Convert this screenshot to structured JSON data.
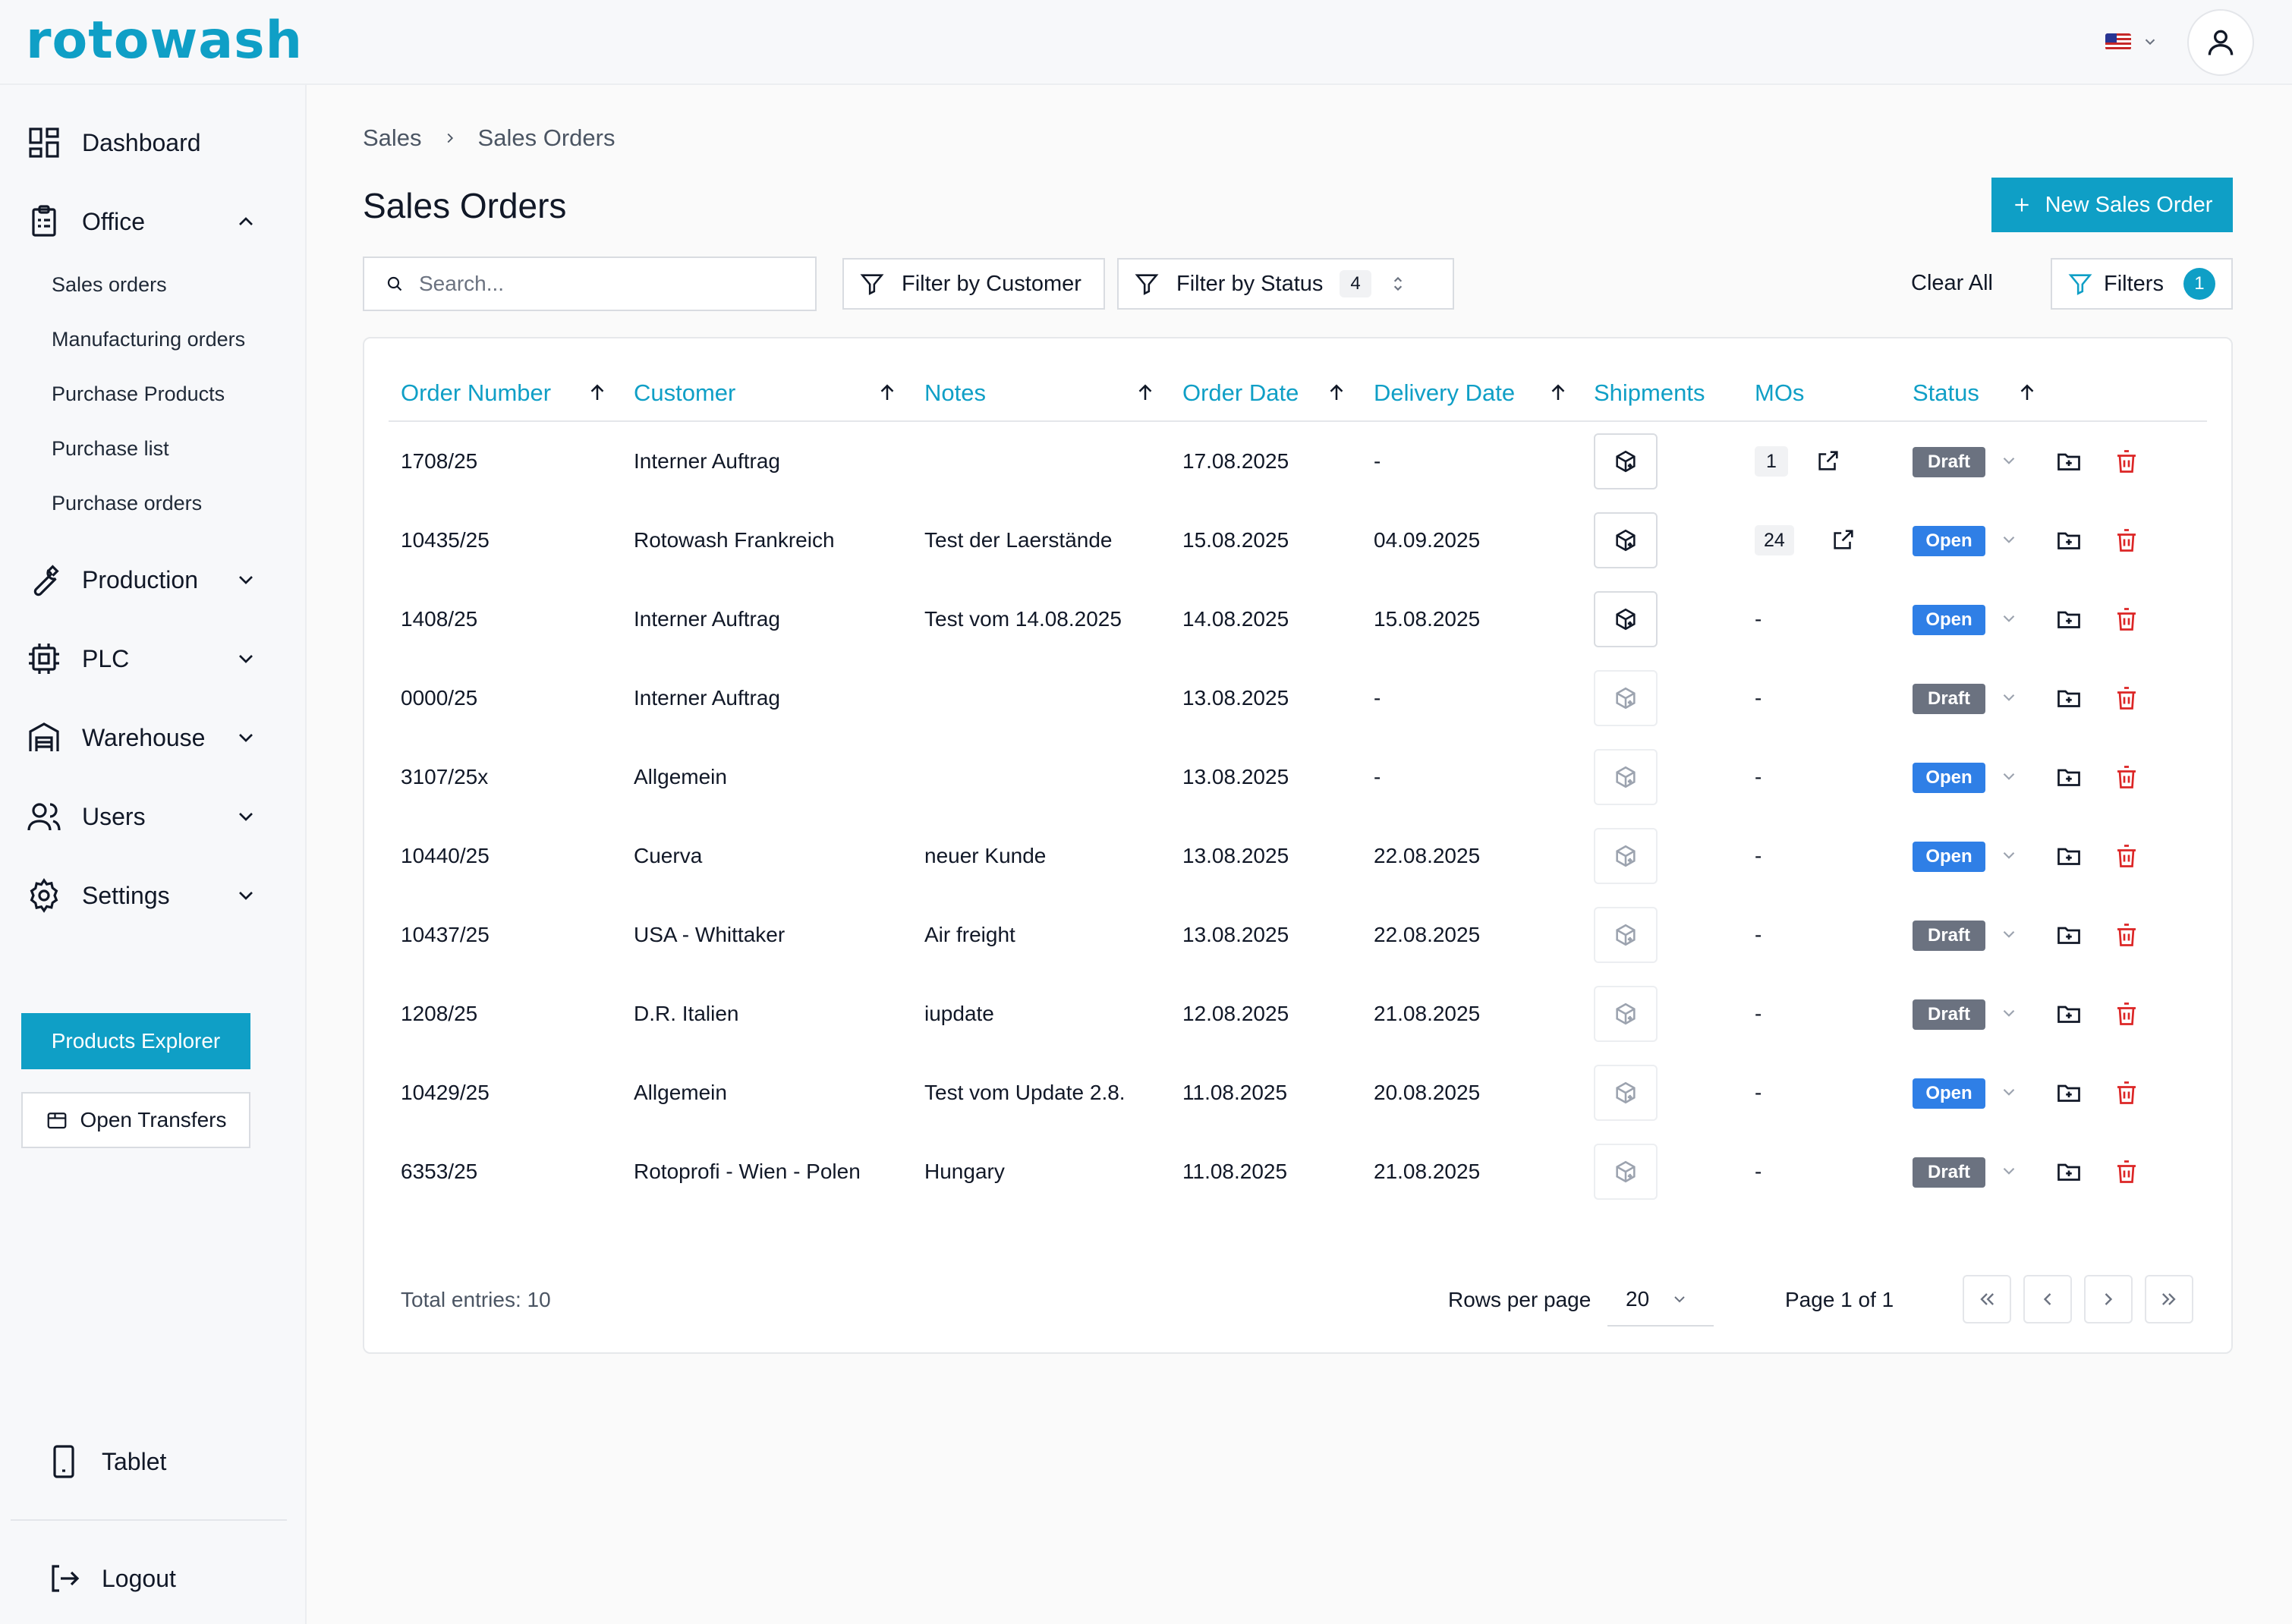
{
  "app": {
    "logo": "rotowash"
  },
  "header": {
    "language_flag": "us-flag",
    "avatar_icon": "user-icon"
  },
  "sidebar": {
    "dashboard": "Dashboard",
    "office": "Office",
    "office_items": [
      "Sales orders",
      "Manufacturing orders",
      "Purchase Products",
      "Purchase list",
      "Purchase orders"
    ],
    "production": "Production",
    "plc": "PLC",
    "warehouse": "Warehouse",
    "users": "Users",
    "settings": "Settings",
    "products_explorer": "Products Explorer",
    "open_transfers": "Open Transfers",
    "tablet": "Tablet",
    "logout": "Logout"
  },
  "breadcrumb": {
    "root": "Sales",
    "current": "Sales Orders"
  },
  "page": {
    "title": "Sales Orders",
    "new_button": "New Sales Order"
  },
  "toolbar": {
    "search_placeholder": "Search...",
    "filter_customer": "Filter by Customer",
    "filter_status": "Filter by Status",
    "filter_status_count": "4",
    "clear_all": "Clear All",
    "filters": "Filters",
    "filters_count": "1"
  },
  "table": {
    "columns": [
      "Order Number",
      "Customer",
      "Notes",
      "Order Date",
      "Delivery Date",
      "Shipments",
      "MOs",
      "Status"
    ],
    "rows": [
      {
        "order": "1708/25",
        "customer": "Interner Auftrag",
        "notes": "",
        "order_date": "17.08.2025",
        "delivery": "-",
        "shipments": true,
        "mos": "1",
        "status": "Draft"
      },
      {
        "order": "10435/25",
        "customer": "Rotowash Frankreich",
        "notes": "Test der Laerstände",
        "order_date": "15.08.2025",
        "delivery": "04.09.2025",
        "shipments": true,
        "mos": "24",
        "status": "Open"
      },
      {
        "order": "1408/25",
        "customer": "Interner Auftrag",
        "notes": "Test vom 14.08.2025",
        "order_date": "14.08.2025",
        "delivery": "15.08.2025",
        "shipments": true,
        "mos": "-",
        "status": "Open"
      },
      {
        "order": "0000/25",
        "customer": "Interner Auftrag",
        "notes": "",
        "order_date": "13.08.2025",
        "delivery": "-",
        "shipments": false,
        "mos": "-",
        "status": "Draft"
      },
      {
        "order": "3107/25x",
        "customer": "Allgemein",
        "notes": "",
        "order_date": "13.08.2025",
        "delivery": "-",
        "shipments": false,
        "mos": "-",
        "status": "Open"
      },
      {
        "order": "10440/25",
        "customer": "Cuerva",
        "notes": "neuer Kunde",
        "order_date": "13.08.2025",
        "delivery": "22.08.2025",
        "shipments": false,
        "mos": "-",
        "status": "Open"
      },
      {
        "order": "10437/25",
        "customer": "USA - Whittaker",
        "notes": "Air freight",
        "order_date": "13.08.2025",
        "delivery": "22.08.2025",
        "shipments": false,
        "mos": "-",
        "status": "Draft"
      },
      {
        "order": "1208/25",
        "customer": "D.R. Italien",
        "notes": "iupdate",
        "order_date": "12.08.2025",
        "delivery": "21.08.2025",
        "shipments": false,
        "mos": "-",
        "status": "Draft"
      },
      {
        "order": "10429/25",
        "customer": "Allgemein",
        "notes": "Test vom Update 2.8.",
        "order_date": "11.08.2025",
        "delivery": "20.08.2025",
        "shipments": false,
        "mos": "-",
        "status": "Open"
      },
      {
        "order": "6353/25",
        "customer": "Rotoprofi - Wien - Polen",
        "notes": "Hungary",
        "order_date": "11.08.2025",
        "delivery": "21.08.2025",
        "shipments": false,
        "mos": "-",
        "status": "Draft"
      }
    ]
  },
  "footer": {
    "total": "Total entries: 10",
    "rows_per_page_label": "Rows per page",
    "rows_per_page": "20",
    "page_info": "Page 1 of 1"
  },
  "colors": {
    "accent": "#0f9fc6",
    "open": "#2f7fe6",
    "draft": "#6b7280",
    "danger": "#dc2626"
  }
}
